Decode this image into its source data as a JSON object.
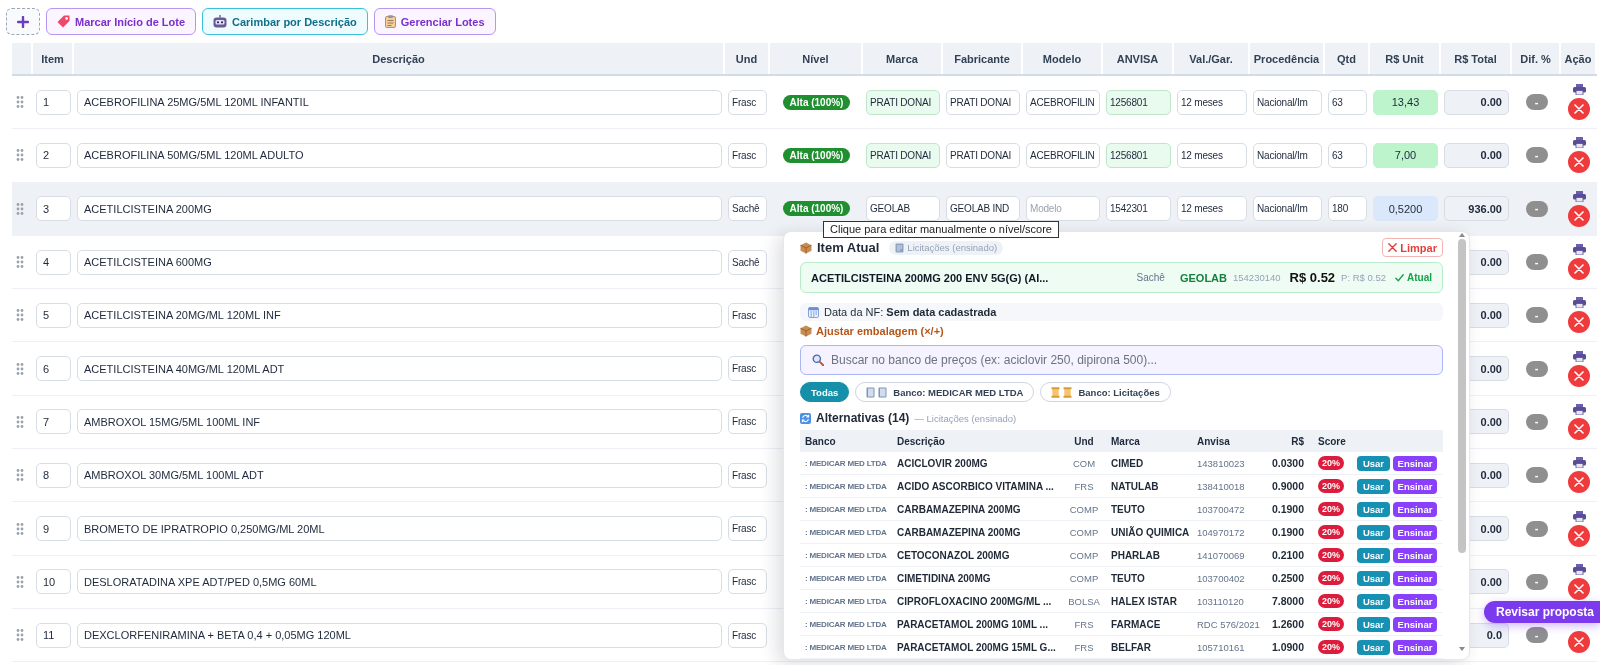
{
  "toolbar": [
    {
      "kind": "add"
    },
    {
      "kind": "mark",
      "label": "Marcar Início de Lote"
    },
    {
      "kind": "stamp",
      "label": "Carimbar por Descrição"
    },
    {
      "kind": "manage",
      "label": "Gerenciar Lotes"
    }
  ],
  "table": {
    "columns": [
      "Item",
      "Descrição",
      "Und",
      "Nível",
      "Marca",
      "Fabricante",
      "Modelo",
      "ANVISA",
      "Val./Gar.",
      "Procedência",
      "Qtd",
      "R$ Unit",
      "R$ Total",
      "Dif. %",
      "Ação"
    ],
    "rows": [
      {
        "item": "1",
        "description": "ACEBROFILINA 25MG/5ML 120ML INFANTIL",
        "unit": "Frasc",
        "level_badge": {
          "label": "Alta (100%)",
          "color": "#1f8f2f"
        },
        "brand": "PRATI DONAI",
        "manufacturer": "PRATI DONAI",
        "model": "ACEBROFILIN",
        "anvisa": "1256801",
        "warranty": "12 meses",
        "origin": "Nacional/Im",
        "qty": "63",
        "unit_price": {
          "value": "13,43",
          "color": "#bdf4cc"
        },
        "total": "0.00",
        "dif": "-",
        "matched": true,
        "selected": false,
        "actions": [
          {
            "kind": "print"
          },
          {
            "kind": "delete"
          }
        ]
      },
      {
        "item": "2",
        "description": "ACEBROFILINA 50MG/5ML 120ML ADULTO",
        "unit": "Frasc",
        "level_badge": {
          "label": "Alta (100%)",
          "color": "#1f8f2f"
        },
        "brand": "PRATI DONAI",
        "manufacturer": "PRATI DONAI",
        "model": "ACEBROFILIN",
        "anvisa": "1256801",
        "warranty": "12 meses",
        "origin": "Nacional/Im",
        "qty": "63",
        "unit_price": {
          "value": "7,00",
          "color": "#bdf4cc"
        },
        "total": "0.00",
        "dif": "-",
        "matched": true,
        "selected": false,
        "actions": [
          {
            "kind": "print"
          },
          {
            "kind": "delete"
          }
        ]
      },
      {
        "item": "3",
        "description": "ACETILCISTEINA 200MG",
        "unit": "Sachê",
        "level_badge": {
          "label": "Alta (100%)",
          "color": "#1f8f2f"
        },
        "brand": "GEOLAB",
        "manufacturer": "GEOLAB IND",
        "model_placeholder": "Modelo",
        "anvisa": "1542301",
        "warranty": "12 meses",
        "origin": "Nacional/Im",
        "qty": "180",
        "unit_price": {
          "value": "0,5200",
          "color": "#dbe7fa"
        },
        "total": "936.00",
        "dif": "-",
        "matched": false,
        "selected": true,
        "actions": [
          {
            "kind": "print"
          },
          {
            "kind": "delete"
          }
        ]
      },
      {
        "item": "4",
        "description": "ACETILCISTEINA 600MG",
        "unit": "Sachê",
        "total": "0.00",
        "dif": "-",
        "selected": false,
        "actions": [
          {
            "kind": "print"
          },
          {
            "kind": "delete"
          }
        ]
      },
      {
        "item": "5",
        "description": "ACETILCISTEINA 20MG/ML 120ML INF",
        "unit": "Frasc",
        "total": "0.00",
        "dif": "-",
        "selected": false,
        "actions": [
          {
            "kind": "print"
          },
          {
            "kind": "delete"
          }
        ]
      },
      {
        "item": "6",
        "description": "ACETILCISTEINA 40MG/ML 120ML ADT",
        "unit": "Frasc",
        "total": "0.00",
        "dif": "-",
        "selected": false,
        "actions": [
          {
            "kind": "print"
          },
          {
            "kind": "delete"
          }
        ]
      },
      {
        "item": "7",
        "description": "AMBROXOL 15MG/5ML 100ML INF",
        "unit": "Frasc",
        "total": "0.00",
        "dif": "-",
        "selected": false,
        "actions": [
          {
            "kind": "print"
          },
          {
            "kind": "delete"
          }
        ]
      },
      {
        "item": "8",
        "description": "AMBROXOL 30MG/5ML 100ML ADT",
        "unit": "Frasc",
        "total": "0.00",
        "dif": "-",
        "selected": false,
        "actions": [
          {
            "kind": "print"
          },
          {
            "kind": "delete"
          }
        ]
      },
      {
        "item": "9",
        "description": "BROMETO DE IPRATROPIO 0,250MG/ML 20ML",
        "unit": "Frasc",
        "total": "0.00",
        "dif": "-",
        "selected": false,
        "actions": [
          {
            "kind": "print"
          },
          {
            "kind": "delete"
          }
        ]
      },
      {
        "item": "10",
        "description": "DESLORATADINA XPE ADT/PED 0,5MG 60ML",
        "unit": "Frasc",
        "total": "0.00",
        "dif": "-",
        "selected": false,
        "actions": [
          {
            "kind": "print"
          },
          {
            "kind": "delete"
          }
        ]
      },
      {
        "item": "11",
        "description": "DEXCLORFENIRAMINA + BETA 0,4 + 0,05MG 120ML",
        "unit": "Frasc",
        "total": "0.0",
        "dif": "-",
        "selected": false,
        "actions": [
          {
            "kind": "delete"
          }
        ]
      }
    ]
  },
  "tooltip": {
    "text": "Clique para editar manualmente o nível/score"
  },
  "price_panel": {
    "header": {
      "title": "Item Atual",
      "badge": "Licitações (ensinado)",
      "clear_button": "Limpar"
    },
    "current_item": {
      "description": "ACETILCISTEINA 200MG 200 ENV 5G(G) (AI...",
      "unit": "Sachê",
      "brand": "GEOLAB",
      "anvisa": "154230140",
      "price": "R$ 0.52",
      "previous_price": "P: R$ 0.52",
      "status": "Atual"
    },
    "invoice_date": "Data da NF: **Sem data cadastrada**",
    "adjust_link": "Ajustar embalagem (×/+)",
    "search": {
      "placeholder": "Buscar no banco de preços (ex: aciclovir 250, dipirona 500)..."
    },
    "filters": [
      {
        "kind": "all",
        "label": "Todas",
        "selected": true
      },
      {
        "kind": "bank",
        "label": "Banco: MEDICAR MED LTDA",
        "selected": false
      },
      {
        "kind": "bids",
        "label": "Banco: Licitações",
        "selected": false
      }
    ],
    "alternatives": {
      "title": "Alternativas (14)",
      "source": "— Licitações (ensinado)",
      "columns": [
        "Banco",
        "Descrição",
        "Und",
        "Marca",
        "Anvisa",
        "R$",
        "Score"
      ],
      "rows": [
        {
          "bank": ": MEDICAR MED LTDA",
          "description": "ACICLOVIR 200MG",
          "unit": "COM",
          "brand": "CIMED",
          "anvisa": "143810023",
          "price": "0.0300",
          "score": "20%",
          "use_button": "Usar",
          "teach_button": "Ensinar"
        },
        {
          "bank": ": MEDICAR MED LTDA",
          "description": "ACIDO ASCORBICO VITAMINA ...",
          "unit": "FRS",
          "brand": "NATULAB",
          "anvisa": "138410018",
          "price": "0.9000",
          "score": "20%",
          "use_button": "Usar",
          "teach_button": "Ensinar"
        },
        {
          "bank": ": MEDICAR MED LTDA",
          "description": "CARBAMAZEPINA 200MG",
          "unit": "COMP",
          "brand": "TEUTO",
          "anvisa": "103700472",
          "price": "0.1900",
          "score": "20%",
          "use_button": "Usar",
          "teach_button": "Ensinar"
        },
        {
          "bank": ": MEDICAR MED LTDA",
          "description": "CARBAMAZEPINA 200MG",
          "unit": "COMP",
          "brand": "UNIÃO QUIMICA",
          "anvisa": "104970172",
          "price": "0.1900",
          "score": "20%",
          "use_button": "Usar",
          "teach_button": "Ensinar"
        },
        {
          "bank": ": MEDICAR MED LTDA",
          "description": "CETOCONAZOL 200MG",
          "unit": "COMP",
          "brand": "PHARLAB",
          "anvisa": "141070069",
          "price": "0.2100",
          "score": "20%",
          "use_button": "Usar",
          "teach_button": "Ensinar"
        },
        {
          "bank": ": MEDICAR MED LTDA",
          "description": "CIMETIDINA 200MG",
          "unit": "COMP",
          "brand": "TEUTO",
          "anvisa": "103700402",
          "price": "0.2500",
          "score": "20%",
          "use_button": "Usar",
          "teach_button": "Ensinar"
        },
        {
          "bank": ": MEDICAR MED LTDA",
          "description": "CIPROFLOXACINO 200MG/ML ...",
          "unit": "BOLSA",
          "brand": "HALEX ISTAR",
          "anvisa": "103110120",
          "price": "7.8000",
          "score": "20%",
          "use_button": "Usar",
          "teach_button": "Ensinar"
        },
        {
          "bank": ": MEDICAR MED LTDA",
          "description": "PARACETAMOL 200MG 10ML ...",
          "unit": "FRS",
          "brand": "FARMACE",
          "anvisa": "RDC 576/2021",
          "price": "1.2600",
          "score": "20%",
          "use_button": "Usar",
          "teach_button": "Ensinar"
        },
        {
          "bank": ": MEDICAR MED LTDA",
          "description": "PARACETAMOL 200MG 15ML G...",
          "unit": "FRS",
          "brand": "BELFAR",
          "anvisa": "105710161",
          "price": "1.0900",
          "score": "20%",
          "use_button": "Usar",
          "teach_button": "Ensinar"
        }
      ]
    }
  },
  "review_button": "Revisar proposta"
}
